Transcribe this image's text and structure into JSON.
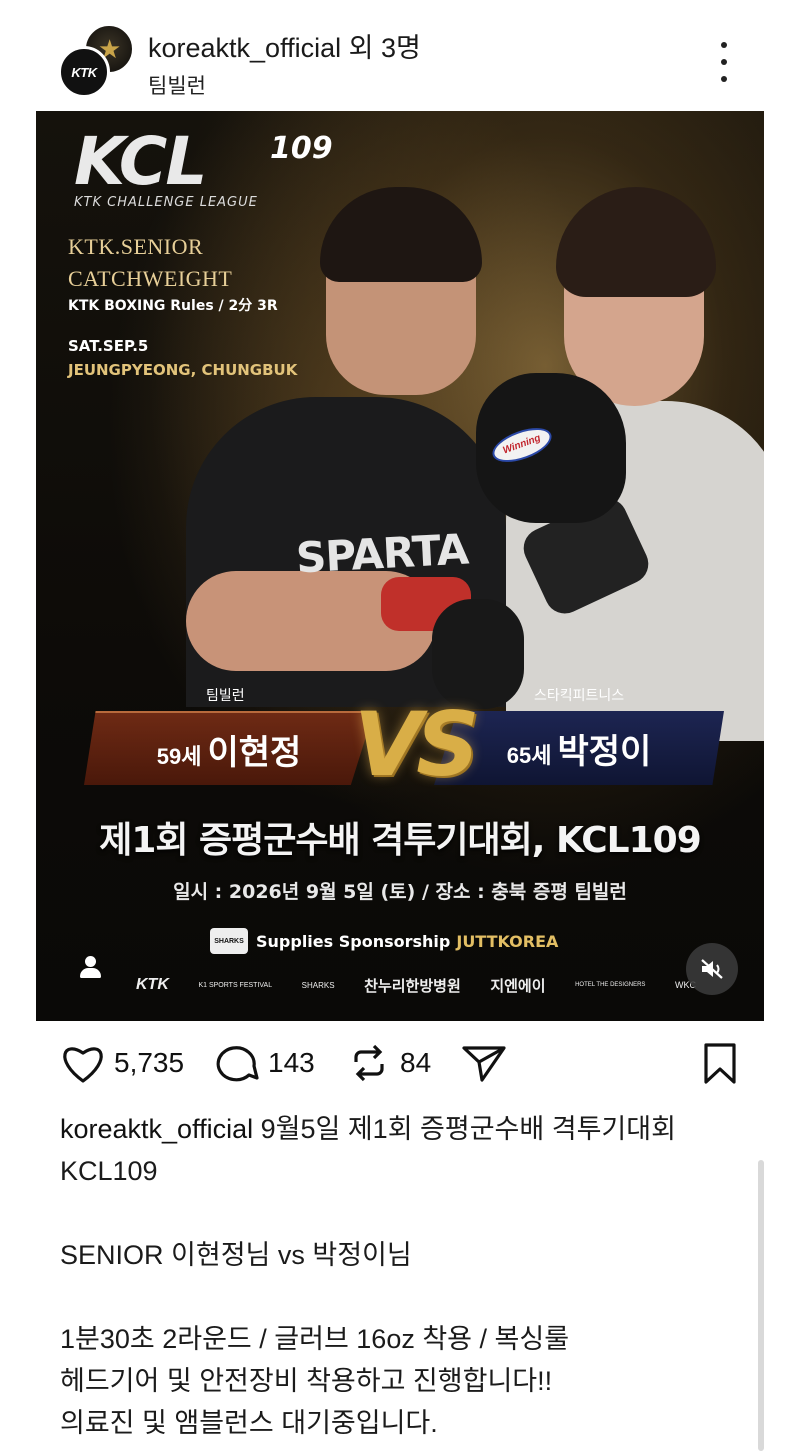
{
  "header": {
    "account_handle": "koreaktk_official",
    "others": "외 3명",
    "location": "팀빌런",
    "avatar_front_text": "KTK"
  },
  "poster": {
    "logo_main": "KCL",
    "logo_number": "109",
    "logo_sub": "KTK CHALLENGE LEAGUE",
    "event_line1": "KTK.SENIOR",
    "event_line2": "CATCHWEIGHT",
    "rules": "KTK BOXING Rules / 2分 3R",
    "date": "SAT.SEP.5",
    "venue": "JEUNGPYEONG, CHUNGBUK",
    "shirt_text": "SPARTA",
    "glove_brand": "Winning",
    "left_team": "팀빌런",
    "left_age": "59세",
    "left_name": "이현정",
    "right_team": "스타킥피트니스",
    "right_age": "65세",
    "right_name": "박정이",
    "vs": "VS",
    "main_title": "제1회 증평군수배 격투기대회, KCL109",
    "schedule": "일시 : 2026년 9월 5일 (토) / 장소 : 충북 증평 팀빌런",
    "sponsor_label": "Supplies Sponsorship",
    "sponsor_brand": "JUTTKOREA",
    "sponsor_badge": "SHARKS",
    "logo_items": [
      "KTK",
      "K1 SPORTS FESTIVAL",
      "SHARKS",
      "찬누리한방병원",
      "지엔에이",
      "HOTEL THE DESIGNERS",
      "WKC"
    ]
  },
  "actions": {
    "likes": "5,735",
    "comments": "143",
    "reposts": "84"
  },
  "caption": {
    "handle": "koreaktk_official",
    "line1": "9월5일 제1회 증평군수배 격투기대회",
    "line2": "KCL109",
    "line3": "SENIOR 이현정님 vs 박정이님",
    "line4": "1분30초 2라운드 / 글러브 16oz 착용 / 복싱룰",
    "line5": "헤드기어 및 안전장비 착용하고 진행합니다!!",
    "line6": "의료진 및 앰블런스 대기중입니다."
  }
}
